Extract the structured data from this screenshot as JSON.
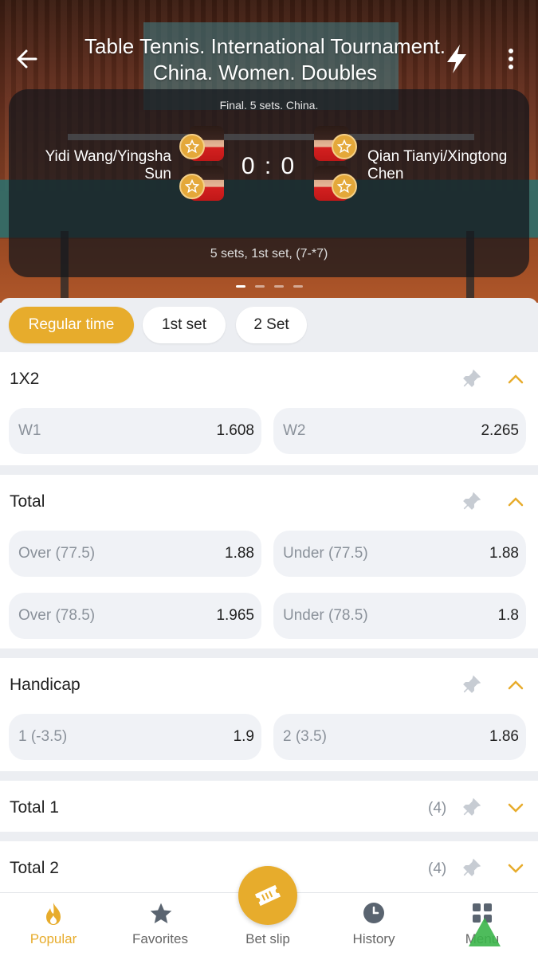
{
  "header": {
    "title": "Table Tennis. International Tournament. China. Women. Doubles",
    "icons": {
      "back": "arrow-left-icon",
      "live": "lightning-icon",
      "more": "more-vertical-icon"
    }
  },
  "match": {
    "stage": "Final. 5 sets. China.",
    "team1": "Yidi Wang/Yingsha Sun",
    "team2": "Qian Tianyi/Xingtong Chen",
    "score": "0 : 0",
    "period": "5 sets, 1st set, (7-*7)",
    "carousel_pages": 4,
    "carousel_active": 0
  },
  "tabs": [
    {
      "label": "Regular time",
      "active": true
    },
    {
      "label": "1st set",
      "active": false
    },
    {
      "label": "2 Set",
      "active": false
    }
  ],
  "markets": {
    "m1x2": {
      "title": "1X2",
      "odds": [
        {
          "label": "W1",
          "value": "1.608"
        },
        {
          "label": "W2",
          "value": "2.265"
        }
      ]
    },
    "total": {
      "title": "Total",
      "odds": [
        {
          "label": "Over (77.5)",
          "value": "1.88"
        },
        {
          "label": "Under (77.5)",
          "value": "1.88"
        },
        {
          "label": "Over (78.5)",
          "value": "1.965"
        },
        {
          "label": "Under (78.5)",
          "value": "1.8"
        }
      ]
    },
    "handicap": {
      "title": "Handicap",
      "odds": [
        {
          "label": "1 (-3.5)",
          "value": "1.9"
        },
        {
          "label": "2 (3.5)",
          "value": "1.86"
        }
      ]
    },
    "total1": {
      "title": "Total 1",
      "count": "(4)"
    },
    "total2": {
      "title": "Total 2",
      "count": "(4)"
    }
  },
  "bottom_nav": {
    "popular": "Popular",
    "favorites": "Favorites",
    "betslip": "Bet slip",
    "history": "History",
    "menu": "Menu"
  },
  "colors": {
    "accent": "#e7ac2c",
    "text": "#222222",
    "muted": "#8a919a",
    "card": "#f0f2f6"
  }
}
